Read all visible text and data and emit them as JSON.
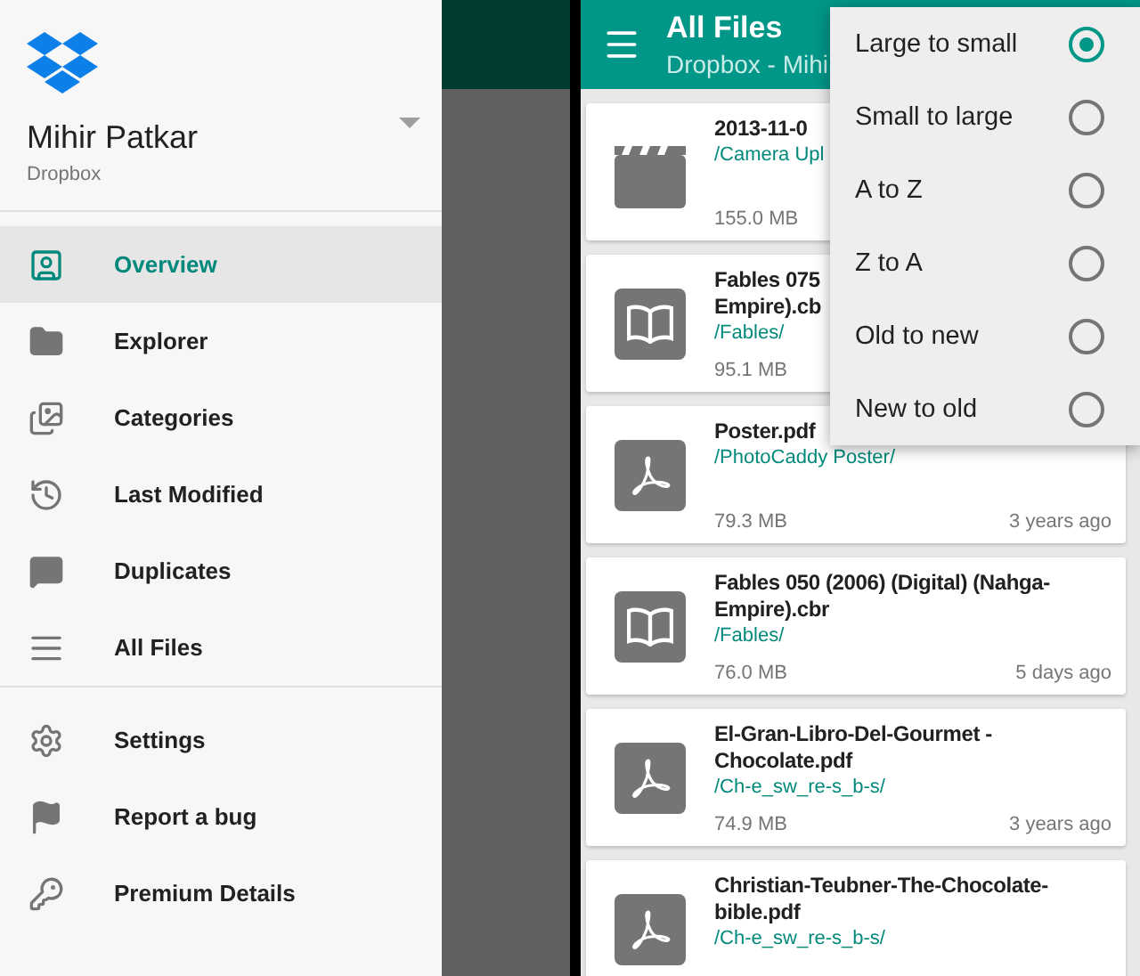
{
  "drawer": {
    "account_name": "Mihir Patkar",
    "account_service": "Dropbox",
    "sections": [
      {
        "items": [
          {
            "label": "Overview",
            "selected": true
          },
          {
            "label": "Explorer",
            "selected": false
          },
          {
            "label": "Categories",
            "selected": false
          },
          {
            "label": "Last Modified",
            "selected": false
          },
          {
            "label": "Duplicates",
            "selected": false
          },
          {
            "label": "All Files",
            "selected": false
          }
        ]
      },
      {
        "items": [
          {
            "label": "Settings",
            "selected": false
          },
          {
            "label": "Report a bug",
            "selected": false
          },
          {
            "label": "Premium Details",
            "selected": false
          }
        ]
      }
    ]
  },
  "files_screen": {
    "title": "All Files",
    "subtitle": "Dropbox - Mihi",
    "files": [
      {
        "kind": "video",
        "title_lines": [
          "2013-11-0"
        ],
        "path": "/Camera Upl",
        "size": "155.0 MB"
      },
      {
        "kind": "comic",
        "title_lines": [
          "Fables 075",
          "Empire).cb"
        ],
        "path": "/Fables/",
        "size": "95.1 MB"
      },
      {
        "kind": "pdf",
        "title_lines": [
          "Poster.pdf"
        ],
        "path": "/PhotoCaddy Poster/",
        "size": "79.3 MB",
        "date": "3 years ago"
      },
      {
        "kind": "comic",
        "title_lines": [
          "Fables 050 (2006) (Digital) (Nahga-",
          "Empire).cbr"
        ],
        "path": "/Fables/",
        "size": "76.0 MB",
        "date": "5 days ago"
      },
      {
        "kind": "pdf",
        "title_lines": [
          "El-Gran-Libro-Del-Gourmet -",
          "Chocolate.pdf"
        ],
        "path": "/Ch-e_sw_re-s_b-s/",
        "size": "74.9 MB",
        "date": "3 years ago"
      },
      {
        "kind": "pdf",
        "title_lines": [
          "Christian-Teubner-The-Chocolate-",
          "bible.pdf"
        ],
        "path": "/Ch-e_sw_re-s_b-s/"
      }
    ]
  },
  "sort_menu": {
    "options": [
      {
        "label": "Large to small",
        "selected": true
      },
      {
        "label": "Small to large",
        "selected": false
      },
      {
        "label": "A to Z",
        "selected": false
      },
      {
        "label": "Z to A",
        "selected": false
      },
      {
        "label": "Old to new",
        "selected": false
      },
      {
        "label": "New to old",
        "selected": false
      }
    ]
  }
}
